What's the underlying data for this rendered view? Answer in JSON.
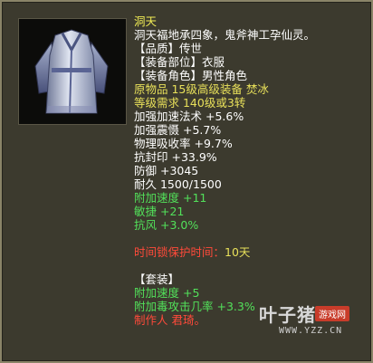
{
  "item": {
    "name": "洞天",
    "description": "洞天福地承四象，鬼斧神工孕仙灵。",
    "quality": "【品质】传世",
    "slot": "【装备部位】衣服",
    "role": "【装备角色】男性角色",
    "origin": "原物品 15级高级装备 焚冰",
    "requirement": "等级需求 140级或3转",
    "stats_white": [
      "加强加速法术 +5.6%",
      "加强震慑 +5.7%",
      "物理吸收率 +9.7%",
      "抗封印 +33.9%",
      "防御 +3045",
      "耐久 1500/1500"
    ],
    "stats_green": [
      "附加速度 +11",
      "敏捷 +21",
      "抗风 +3.0%"
    ],
    "lock_label": "时间锁保护时间：",
    "lock_value": "10天",
    "set_header": "【套装】",
    "set_bonuses": [
      "附加速度 +5",
      "附加毒攻击几率 +3.3%"
    ],
    "maker": "制作人 君琦。"
  },
  "watermark": {
    "logo": "叶子猪",
    "tag": "游戏网",
    "url": "WWW.YZZ.CN"
  },
  "icon": "robe-icon",
  "colors": {
    "title": "#f3ee55",
    "white": "#ffffff",
    "green": "#52e05a",
    "red": "#ff4a3a",
    "panel_bg": "#3c3a2e",
    "border": "#8a8468"
  }
}
